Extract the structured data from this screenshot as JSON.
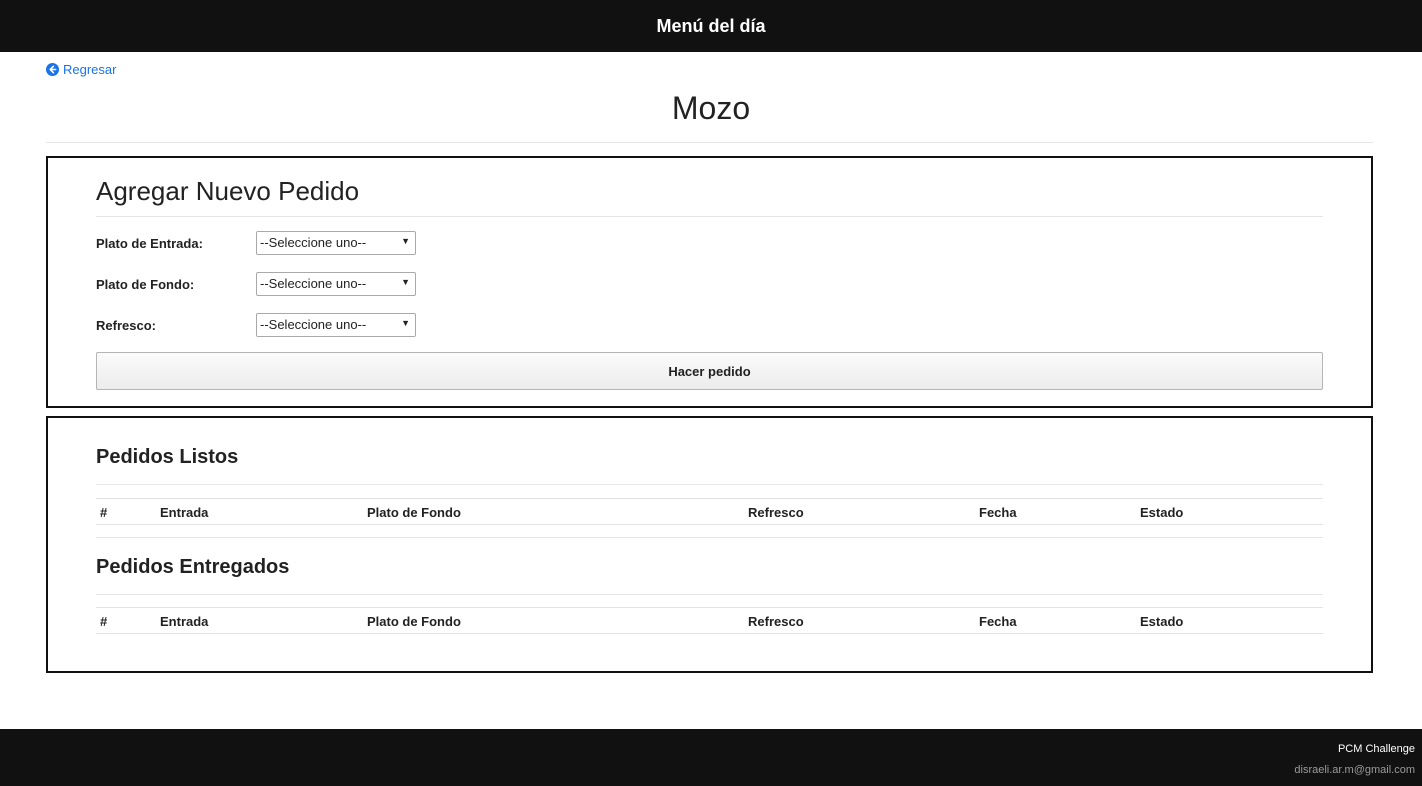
{
  "header": {
    "title": "Menú del día"
  },
  "nav": {
    "back_label": "Regresar"
  },
  "page": {
    "title": "Mozo"
  },
  "new_order": {
    "heading": "Agregar Nuevo Pedido",
    "fields": [
      {
        "label": "Plato de Entrada:",
        "selected": "--Seleccione uno--"
      },
      {
        "label": "Plato de Fondo:",
        "selected": "--Seleccione uno--"
      },
      {
        "label": "Refresco:",
        "selected": "--Seleccione uno--"
      }
    ],
    "submit_label": "Hacer pedido"
  },
  "ready_orders": {
    "heading": "Pedidos Listos",
    "columns": [
      "#",
      "Entrada",
      "Plato de Fondo",
      "Refresco",
      "Fecha",
      "Estado"
    ]
  },
  "delivered_orders": {
    "heading": "Pedidos Entregados",
    "columns": [
      "#",
      "Entrada",
      "Plato de Fondo",
      "Refresco",
      "Fecha",
      "Estado"
    ]
  },
  "footer": {
    "brand": "PCM Challenge",
    "email": "disraeli.ar.m@gmail.com"
  },
  "colors": {
    "topbar": "#111111",
    "link": "#1a73e8",
    "panel_border": "#111111"
  },
  "icons": {
    "back": "arrow-circle-left-icon",
    "select_caret": "caret-down-icon"
  }
}
